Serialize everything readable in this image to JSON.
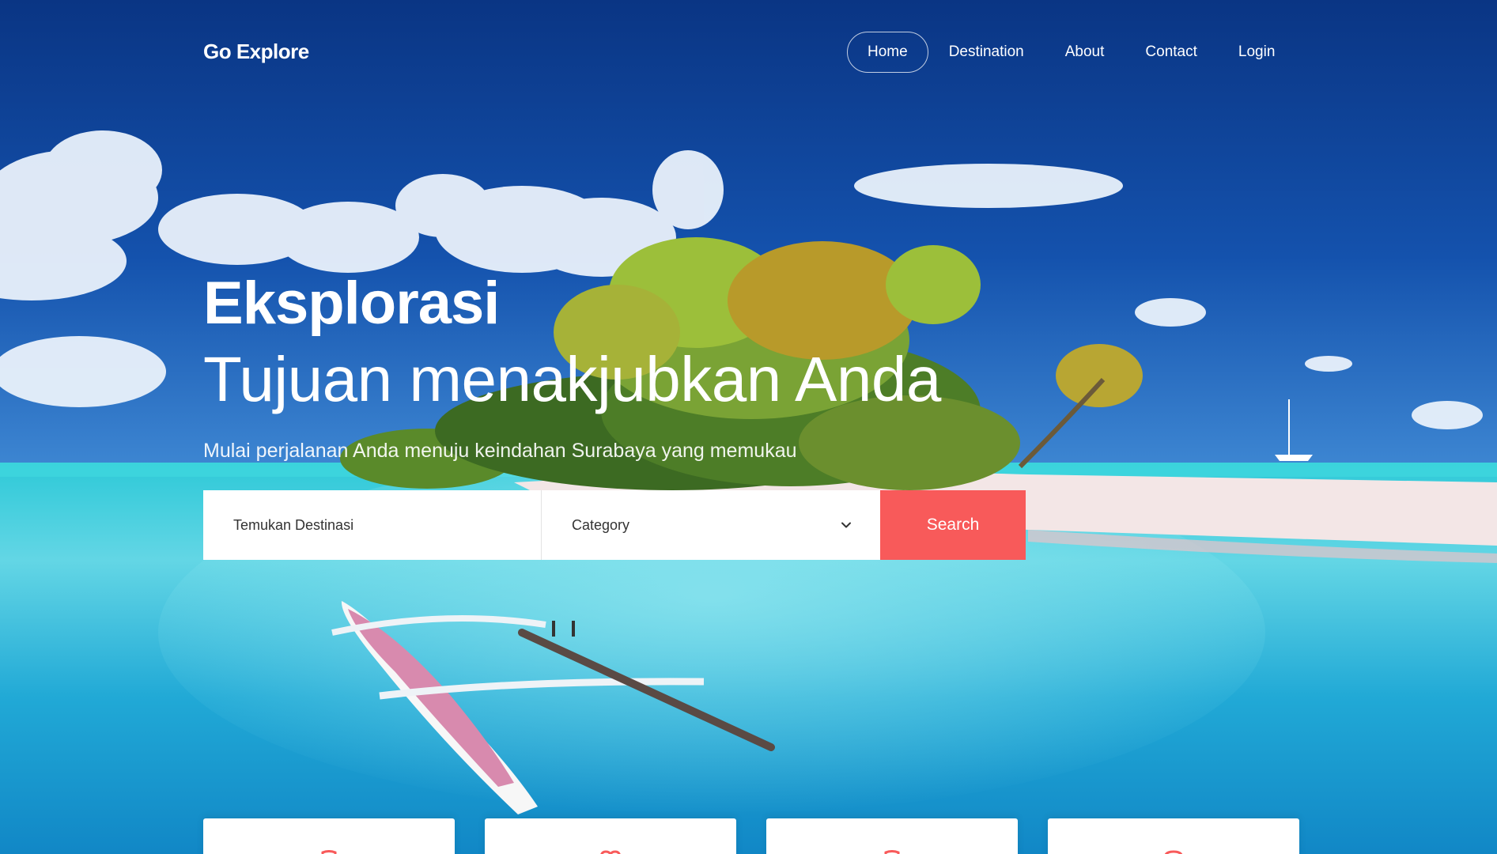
{
  "brand": "Go Explore",
  "nav": {
    "items": [
      {
        "label": "Home",
        "active": true
      },
      {
        "label": "Destination"
      },
      {
        "label": "About"
      },
      {
        "label": "Contact"
      },
      {
        "label": "Login"
      }
    ]
  },
  "hero": {
    "title": "Eksplorasi",
    "subtitle": "Tujuan menakjubkan Anda",
    "description": "Mulai perjalanan Anda menuju keindahan Surabaya yang memukau"
  },
  "search": {
    "destination_placeholder": "Temukan Destinasi",
    "category_label": "Category",
    "button_label": "Search"
  },
  "cards": [
    {
      "icon": "building-icon"
    },
    {
      "icon": "heart-icon"
    },
    {
      "icon": "building-icon"
    },
    {
      "icon": "circle-icon"
    }
  ],
  "colors": {
    "accent": "#f85a5a",
    "sky_top": "#0a3a88",
    "sea": "#2bb8d9"
  }
}
